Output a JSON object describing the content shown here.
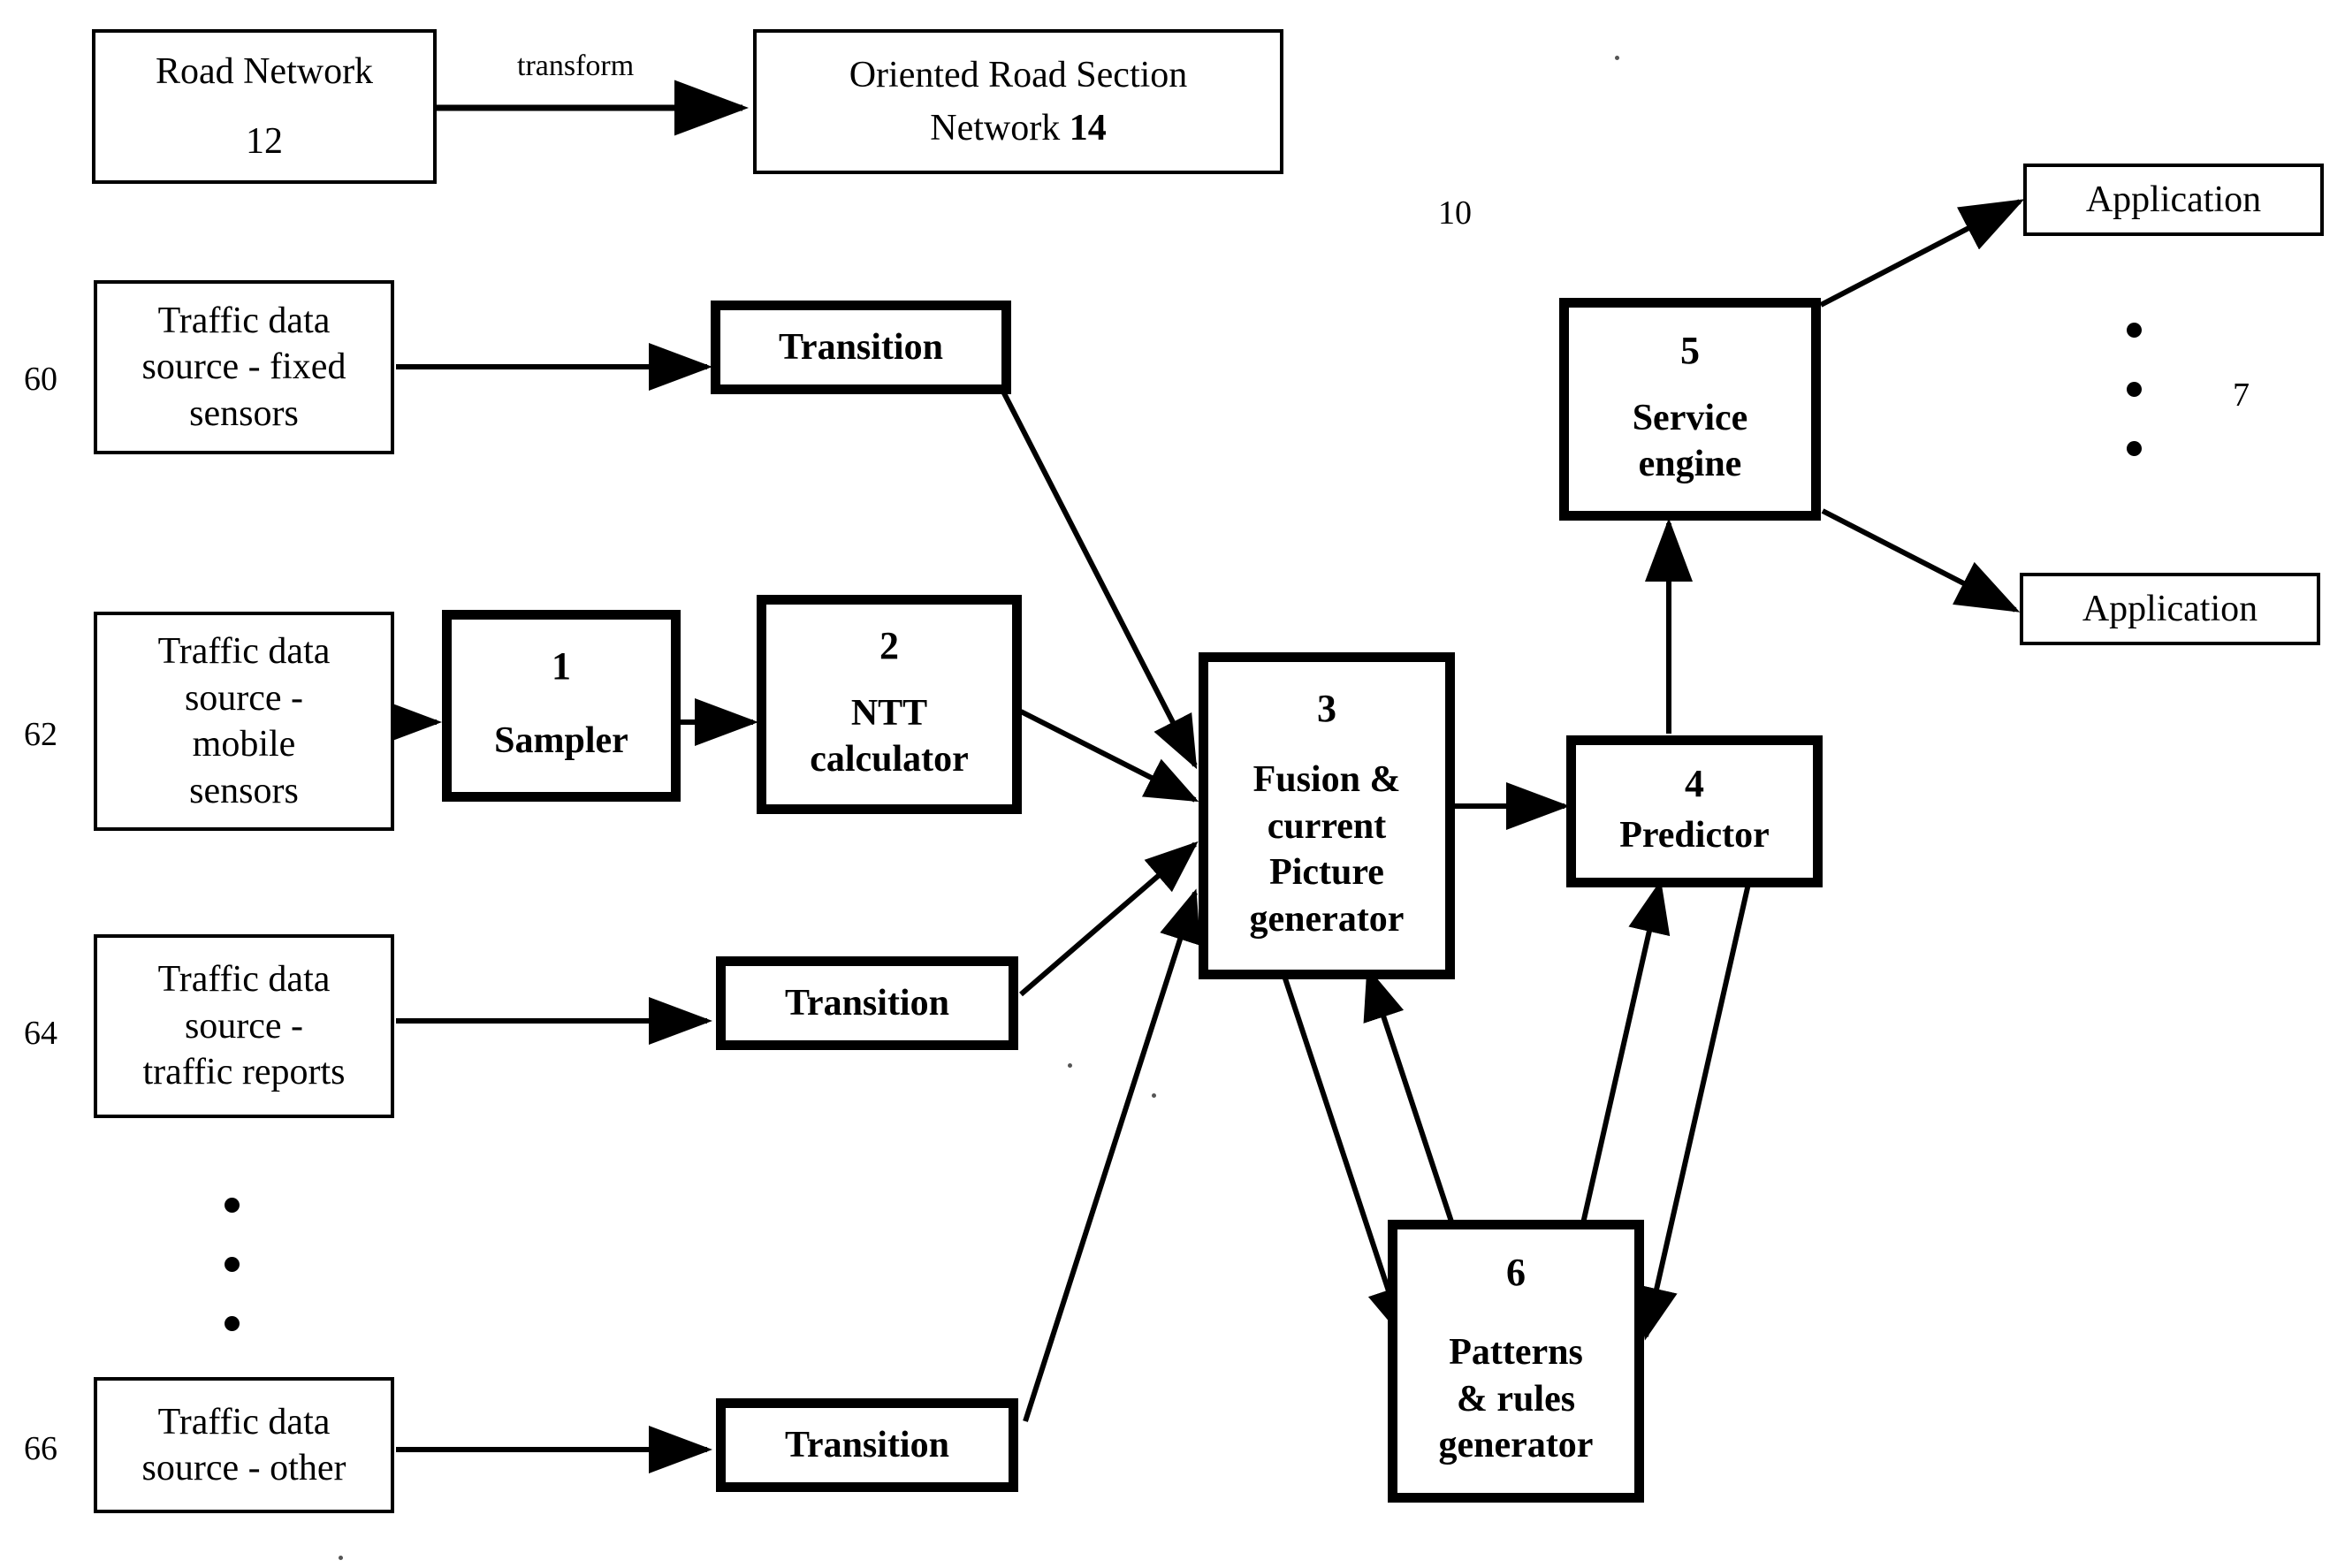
{
  "figure": {
    "reference_numerals": [
      {
        "id": "ref-10",
        "label": "10"
      },
      {
        "id": "ref-60",
        "label": "60"
      },
      {
        "id": "ref-62",
        "label": "62"
      },
      {
        "id": "ref-64",
        "label": "64"
      },
      {
        "id": "ref-66",
        "label": "66"
      },
      {
        "id": "ref-7",
        "label": "7"
      }
    ],
    "edge_labels": [
      {
        "id": "transform",
        "label": "transform"
      }
    ]
  },
  "boxes": {
    "road_network": {
      "title": "Road Network",
      "number": "12"
    },
    "oriented_road_section_network": {
      "line1": "Oriented Road Section",
      "line2": "Network ",
      "number": "14"
    },
    "source_fixed": {
      "line1": "Traffic data",
      "line2": "source - fixed",
      "line3": "sensors"
    },
    "source_mobile": {
      "line1": "Traffic data",
      "line2": "source -",
      "line3": "mobile",
      "line4": "sensors"
    },
    "source_reports": {
      "line1": "Traffic data",
      "line2": "source -",
      "line3": "traffic reports"
    },
    "source_other": {
      "line1": "Traffic data",
      "line2": "source - other"
    },
    "transition_1": {
      "title": "Transition"
    },
    "transition_2": {
      "title": "Transition"
    },
    "transition_3": {
      "title": "Transition"
    },
    "sampler": {
      "number": "1",
      "title": "Sampler"
    },
    "ntt_calculator": {
      "number": "2",
      "line1": "NTT",
      "line2": "calculator"
    },
    "fusion": {
      "number": "3",
      "line1": "Fusion &",
      "line2": "current",
      "line3": "Picture",
      "line4": "generator"
    },
    "predictor": {
      "number": "4",
      "title": "Predictor"
    },
    "service_engine": {
      "number": "5",
      "line1": "Service",
      "line2": "engine"
    },
    "patterns_rules": {
      "number": "6",
      "line1": "Patterns",
      "line2": "& rules",
      "line3": "generator"
    },
    "application_top": {
      "title": "Application"
    },
    "application_bottom": {
      "title": "Application"
    }
  },
  "colors": {
    "ink": "#000000",
    "paper": "#ffffff"
  }
}
